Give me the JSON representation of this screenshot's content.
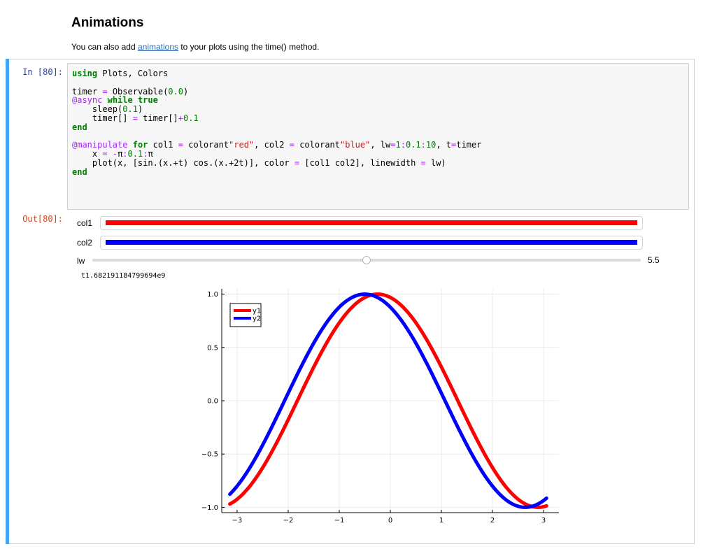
{
  "heading": "Animations",
  "intro": {
    "before": "You can also add ",
    "link": "animations",
    "after": " to your plots using the time() method."
  },
  "cell": {
    "in_prompt": "In [80]:",
    "out_prompt": "Out[80]:",
    "code_lines": [
      [
        {
          "t": "using",
          "c": "kw"
        },
        {
          "t": " Plots, Colors"
        }
      ],
      [],
      [
        {
          "t": "timer "
        },
        {
          "t": "=",
          "c": "op"
        },
        {
          "t": " Observable("
        },
        {
          "t": "0.0",
          "c": "num"
        },
        {
          "t": ")"
        }
      ],
      [
        {
          "t": "@async",
          "c": "mac"
        },
        {
          "t": " "
        },
        {
          "t": "while",
          "c": "kw"
        },
        {
          "t": " "
        },
        {
          "t": "true",
          "c": "kw"
        }
      ],
      [
        {
          "t": "    sleep("
        },
        {
          "t": "0.1",
          "c": "num"
        },
        {
          "t": ")"
        }
      ],
      [
        {
          "t": "    timer[] "
        },
        {
          "t": "=",
          "c": "op"
        },
        {
          "t": " timer[]"
        },
        {
          "t": "+",
          "c": "op"
        },
        {
          "t": "0.1",
          "c": "num"
        }
      ],
      [
        {
          "t": "end",
          "c": "kw"
        }
      ],
      [],
      [
        {
          "t": "@manipulate",
          "c": "mac"
        },
        {
          "t": " "
        },
        {
          "t": "for",
          "c": "kw"
        },
        {
          "t": " col1 "
        },
        {
          "t": "=",
          "c": "op"
        },
        {
          "t": " colorant"
        },
        {
          "t": "\"red\"",
          "c": "str"
        },
        {
          "t": ", col2 "
        },
        {
          "t": "=",
          "c": "op"
        },
        {
          "t": " colorant"
        },
        {
          "t": "\"blue\"",
          "c": "str"
        },
        {
          "t": ", lw"
        },
        {
          "t": "=",
          "c": "op"
        },
        {
          "t": "1",
          "c": "num"
        },
        {
          "t": ":",
          "c": "op"
        },
        {
          "t": "0.1",
          "c": "num"
        },
        {
          "t": ":",
          "c": "op"
        },
        {
          "t": "10",
          "c": "num"
        },
        {
          "t": ", t"
        },
        {
          "t": "=",
          "c": "op"
        },
        {
          "t": "timer"
        }
      ],
      [
        {
          "t": "    x "
        },
        {
          "t": "=",
          "c": "op"
        },
        {
          "t": " "
        },
        {
          "t": "-",
          "c": "op"
        },
        {
          "t": "π"
        },
        {
          "t": ":",
          "c": "op"
        },
        {
          "t": "0.1",
          "c": "num"
        },
        {
          "t": ":",
          "c": "op"
        },
        {
          "t": "π"
        }
      ],
      [
        {
          "t": "    plot(x, [sin.(x.+t) cos.(x.+2t)], color "
        },
        {
          "t": "=",
          "c": "op"
        },
        {
          "t": " [col1 col2], linewidth "
        },
        {
          "t": "=",
          "c": "op"
        },
        {
          "t": " lw)"
        }
      ],
      [
        {
          "t": "end",
          "c": "kw"
        }
      ]
    ]
  },
  "widgets": {
    "col1": {
      "label": "col1",
      "color": "#ff0000"
    },
    "col2": {
      "label": "col2",
      "color": "#0000ff"
    },
    "lw": {
      "label": "lw",
      "value": "5.5",
      "min": 1,
      "max": 10,
      "current": 5.5
    },
    "timer_label": "t1.682191184799694e9"
  },
  "chart_data": {
    "type": "line",
    "title": "",
    "xlabel": "",
    "ylabel": "",
    "xlim": [
      -3.3,
      3.3
    ],
    "ylim": [
      -1.05,
      1.05
    ],
    "xticks": [
      -3,
      -2,
      -1,
      0,
      1,
      2,
      3
    ],
    "xtick_labels": [
      "−3",
      "−2",
      "−1",
      "0",
      "1",
      "2",
      "3"
    ],
    "yticks": [
      1.0,
      0.5,
      0.0,
      -0.5,
      -1.0
    ],
    "ytick_labels": [
      "1.0",
      "0.5",
      "0.0",
      "−0.5",
      "−1.0"
    ],
    "grid": true,
    "legend_position": "top-left",
    "x_range": {
      "start": -3.14159,
      "stop": 3.06,
      "step": 0.1
    },
    "series": [
      {
        "name": "y1",
        "function": "sin(x + 1.82)",
        "color": "#ff0000"
      },
      {
        "name": "y2",
        "function": "cos(x + 0.50)",
        "color": "#0000ff"
      }
    ]
  }
}
